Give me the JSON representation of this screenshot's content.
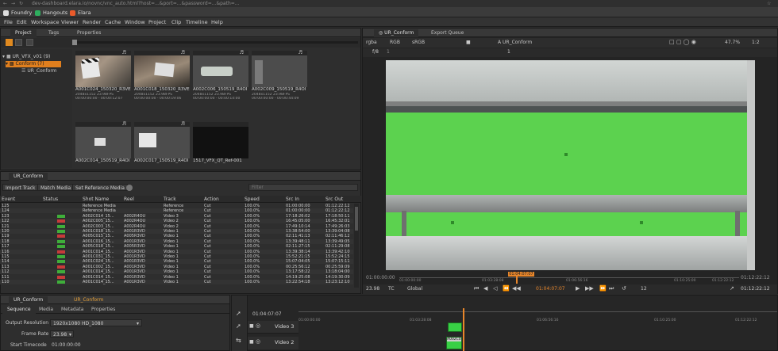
{
  "browser": {
    "url": "dev-dashboard.elara.io/novnc/vnc_auto.html?host=...&port=...&password=...&path=..."
  },
  "bookmarks": [
    {
      "label": "Foundry",
      "color": "#d9d9d9"
    },
    {
      "label": "Hangouts",
      "color": "#2eae5e"
    },
    {
      "label": "Elara",
      "color": "#ea5a2a"
    }
  ],
  "menu": [
    "File",
    "Edit",
    "Workspace",
    "Viewer",
    "Render",
    "Cache",
    "Window",
    "Project",
    "Clip",
    "Timeline",
    "Help"
  ],
  "project_panel": {
    "tabs": [
      "Project",
      "Tags",
      "Properties"
    ],
    "tree": [
      {
        "label": "UR_VFX_v01 (9)",
        "icon": "chevron-down-icon"
      },
      {
        "label": "Conform (7)",
        "icon": "folder-icon",
        "selected": true
      },
      {
        "label": "UR_Conform",
        "icon": "sequence-icon"
      }
    ],
    "thumbs": [
      {
        "name": "A001C024_150320_R3VE",
        "meta1": "2048x1152   23.98FPS",
        "meta2": "00:00:00:00 - 00:00:12:07",
        "scene": "clapper"
      },
      {
        "name": "A001C018_150320_R3VE",
        "meta1": "2048x1152   23.98FPS",
        "meta2": "00:00:00:00 - 00:00:19:06",
        "scene": "clapper2"
      },
      {
        "name": "A002C006_150519_R4OI",
        "meta1": "2048x1152   23.98FPS",
        "meta2": "00:00:00:00 - 00:00:14:00",
        "scene": "green"
      },
      {
        "name": "A002C009_150519_R4OI",
        "meta1": "2048x1152   23.98FPS",
        "meta2": "00:00:00:00 - 00:00:44:09",
        "scene": "green"
      },
      {
        "name": "A002C014_150519_R4OI",
        "meta1": "",
        "meta2": "",
        "scene": "green"
      },
      {
        "name": "A002C017_150519_R4OI",
        "meta1": "",
        "meta2": "",
        "scene": "green"
      },
      {
        "name": "1517_VFX_QT_Ref-001",
        "meta1": "",
        "meta2": "",
        "scene": "black"
      }
    ]
  },
  "event_panel": {
    "title": "UR_Conform",
    "buttons": [
      "Import Track",
      "Match Media",
      "Set Reference Media"
    ],
    "filter_placeholder": "Filter",
    "columns": [
      "Event",
      "Status",
      "Shot Name",
      "Reel",
      "Track",
      "Action",
      "Speed",
      "Src In",
      "Src Out"
    ],
    "rows": [
      {
        "event": "125",
        "status": "none",
        "shot": "Reference Media",
        "reel": "",
        "track": "Reference",
        "action": "Cut",
        "speed": "100.0%",
        "src_in": "01:00:00:00",
        "src_out": "01:12:22:12"
      },
      {
        "event": "124",
        "status": "none",
        "shot": "Reference Media",
        "reel": "",
        "track": "Reference",
        "action": "Cut",
        "speed": "100.0%",
        "src_in": "01:00:00:00",
        "src_out": "01:12:22:12"
      },
      {
        "event": "123",
        "status": "green",
        "shot": "A002C014_15...",
        "reel": "A002R4OU",
        "track": "Video 3",
        "action": "Cut",
        "speed": "100.0%",
        "src_in": "17:18:26:02",
        "src_out": "17:18:50:11"
      },
      {
        "event": "122",
        "status": "red",
        "shot": "A002C005_15...",
        "reel": "A002R4OU",
        "track": "Video 2",
        "action": "Cut",
        "speed": "100.0%",
        "src_in": "16:45:05:00",
        "src_out": "16:45:32:01"
      },
      {
        "event": "121",
        "status": "green",
        "shot": "A002C003_15...",
        "reel": "A002R4OU",
        "track": "Video 2",
        "action": "Cut",
        "speed": "100.0%",
        "src_in": "17:49:10:14",
        "src_out": "17:49:26:03"
      },
      {
        "event": "120",
        "status": "green",
        "shot": "A001C018_15...",
        "reel": "A001R3VD",
        "track": "Video 1",
        "action": "Cut",
        "speed": "100.0%",
        "src_in": "13:38:54:00",
        "src_out": "13:39:04:08"
      },
      {
        "event": "119",
        "status": "red",
        "shot": "A005C015_15...",
        "reel": "A005R3VD",
        "track": "Video 1",
        "action": "Cut",
        "speed": "100.0%",
        "src_in": "02:11:41:13",
        "src_out": "02:11:46:12"
      },
      {
        "event": "118",
        "status": "green",
        "shot": "A001C016_15...",
        "reel": "A001R3VD",
        "track": "Video 1",
        "action": "Cut",
        "speed": "100.0%",
        "src_in": "13:39:48:11",
        "src_out": "13:39:49:05"
      },
      {
        "event": "117",
        "status": "green",
        "shot": "A005C018_15...",
        "reel": "A005R3VD",
        "track": "Video 1",
        "action": "Cut",
        "speed": "100.0%",
        "src_in": "02:11:27:15",
        "src_out": "02:11:29:08"
      },
      {
        "event": "116",
        "status": "red",
        "shot": "A001C014_15...",
        "reel": "A001R3VD",
        "track": "Video 1",
        "action": "Cut",
        "speed": "100.0%",
        "src_in": "13:39:38:14",
        "src_out": "13:39:42:10"
      },
      {
        "event": "115",
        "status": "green",
        "shot": "A001C031_15...",
        "reel": "A001R3VD",
        "track": "Video 1",
        "action": "Cut",
        "speed": "100.0%",
        "src_in": "15:52:21:15",
        "src_out": "15:52:24:15"
      },
      {
        "event": "114",
        "status": "green",
        "shot": "A001C024_15...",
        "reel": "A001R3VD",
        "track": "Video 1",
        "action": "Cut",
        "speed": "100.0%",
        "src_in": "15:07:04:05",
        "src_out": "15:07:15:11"
      },
      {
        "event": "113",
        "status": "red",
        "shot": "A001C002_15...",
        "reel": "A001R3VD",
        "track": "Video 1",
        "action": "Cut",
        "speed": "100.0%",
        "src_in": "00:25:56:12",
        "src_out": "00:25:59:09"
      },
      {
        "event": "112",
        "status": "green",
        "shot": "A001C014_15...",
        "reel": "A001R3VD",
        "track": "Video 1",
        "action": "Cut",
        "speed": "100.0%",
        "src_in": "13:17:58:22",
        "src_out": "13:18:04:00"
      },
      {
        "event": "111",
        "status": "red",
        "shot": "A001C014_15...",
        "reel": "A001R3VD",
        "track": "Video 1",
        "action": "Cut",
        "speed": "100.0%",
        "src_in": "14:19:25:08",
        "src_out": "14:19:30:09"
      },
      {
        "event": "110",
        "status": "green",
        "shot": "A001C014_15...",
        "reel": "A001R3VD",
        "track": "Video 1",
        "action": "Cut",
        "speed": "100.0%",
        "src_in": "13:22:54:18",
        "src_out": "13:23:12:10"
      }
    ]
  },
  "bottom_left": {
    "tabs": [
      "UR_Conform",
      "UR_Conform"
    ],
    "subtabs": [
      "Sequence",
      "Media",
      "Metadata",
      "Properties"
    ],
    "fields": [
      {
        "label": "Output Resolution",
        "value": "1920x1080 HD_1080"
      },
      {
        "label": "Frame Rate",
        "value": "23.98"
      },
      {
        "label": "Start Timecode",
        "value": "01:00:00:00"
      }
    ]
  },
  "viewer": {
    "tabs": [
      "UR_Conform",
      "Export Queue"
    ],
    "channels": "rgba",
    "colorspace": "RGB",
    "lut": "sRGB",
    "clip_name": "A  UR_Conform",
    "zoom": "47.7%",
    "ratio": "1:2",
    "frame_label": "f/8",
    "frame_counter": "1",
    "y_value": "1",
    "timecode_start": "01:00:00:00",
    "timecode_end": "01:12:22:12",
    "current_tc": "01:04:07:07",
    "fps": "23.98",
    "tc_mode": "TC",
    "scope": "Global",
    "step": "12",
    "ruler_ticks": [
      "01:00:00:00",
      "01:03:28:08",
      "01:06:56:16",
      "01:10:25:00",
      "01:12:22:12"
    ],
    "playhead_pct": 34.4
  },
  "timeline": {
    "current_tc": "01:04:07:07",
    "ruler_ticks": [
      "01:00:00:00",
      "01:03:28:08",
      "01:06:56:16",
      "01:10:25:00",
      "01:12:22:12"
    ],
    "tracks": [
      "Video 3",
      "Video 2"
    ],
    "clip_label": "A002C0"
  }
}
